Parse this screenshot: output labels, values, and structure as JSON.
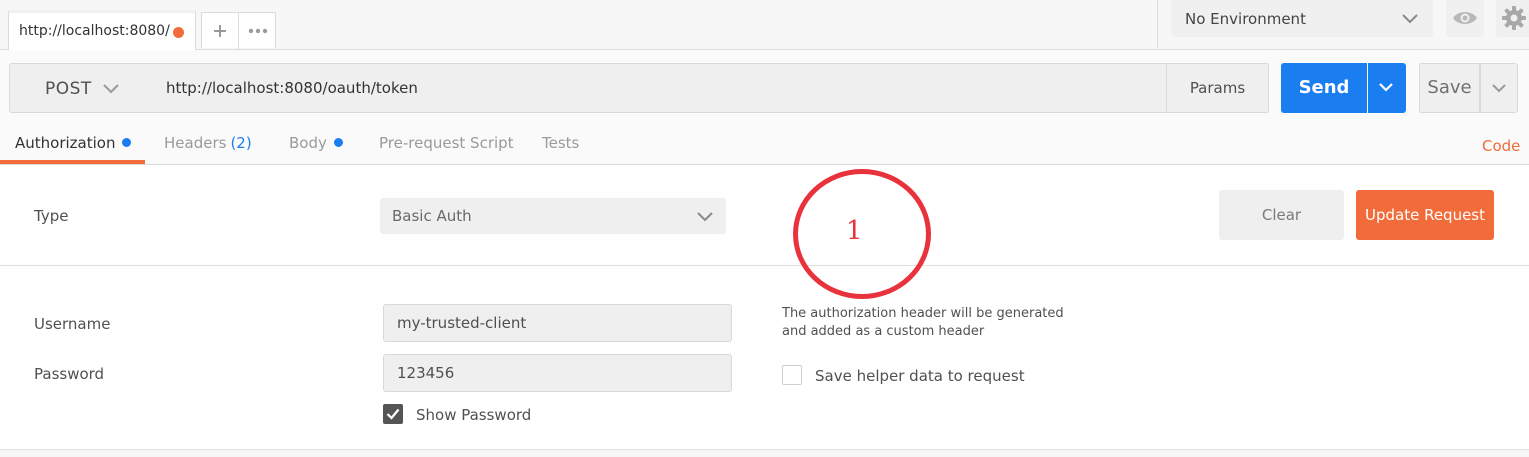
{
  "request_tab": {
    "title": "http://localhost:8080/",
    "unsaved": true
  },
  "tab_actions": {
    "add_icon": "plus-icon",
    "more_icon": "ellipsis-icon"
  },
  "environment": {
    "selected": "No Environment",
    "eye_icon": "eye-icon",
    "settings_icon": "gear-icon"
  },
  "request": {
    "method": "POST",
    "url": "http://localhost:8080/oauth/token",
    "params_label": "Params",
    "send_label": "Send",
    "save_label": "Save"
  },
  "tabs": [
    {
      "label": "Authorization",
      "active": true,
      "indicator": "dot"
    },
    {
      "label": "Headers",
      "count": "(2)"
    },
    {
      "label": "Body",
      "indicator": "dot"
    },
    {
      "label": "Pre-request Script"
    },
    {
      "label": "Tests"
    }
  ],
  "code_link": "Code",
  "auth": {
    "type_label": "Type",
    "type_value": "Basic Auth",
    "clear_label": "Clear",
    "update_label": "Update Request",
    "username_label": "Username",
    "username_value": "my-trusted-client",
    "password_label": "Password",
    "password_value": "123456",
    "show_password_label": "Show Password",
    "show_password_checked": true,
    "helper_note": "The authorization header will be generated and added as a custom header",
    "save_helper_label": "Save helper data to request",
    "save_helper_checked": false
  },
  "annotation": {
    "number": "1",
    "color": "#e8323c"
  },
  "colors": {
    "accent_orange": "#f26b3a",
    "accent_blue": "#1a7ef0"
  }
}
